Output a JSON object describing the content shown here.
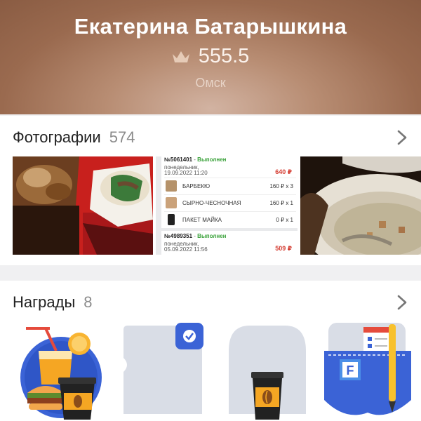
{
  "profile": {
    "name": "Екатерина Батарышкина",
    "score": "555.5",
    "city": "Омск",
    "crown_icon": "crown-icon"
  },
  "photos": {
    "title": "Фотографии",
    "count": "574",
    "chevron_icon": "chevron-right-icon",
    "items": [
      {
        "kind": "food-photo",
        "description": ""
      },
      {
        "kind": "receipt-screenshot",
        "orders": [
          {
            "number": "№5061401",
            "status": "Выполнен",
            "weekday": "понедельник,",
            "datetime": "19.09.2022 11:20",
            "total": "640 ₽",
            "items": [
              {
                "name": "БАРБЕКЮ",
                "qty": "160 ₽ x 3"
              },
              {
                "name": "СЫРНО-ЧЕСНОЧНАЯ",
                "qty": "160 ₽ x 1"
              },
              {
                "name": "ПАКЕТ МАЙКА",
                "qty": "0 ₽ x 1"
              }
            ]
          },
          {
            "number": "№4989351",
            "status": "Выполнен",
            "weekday": "понедельник,",
            "datetime": "05.09.2022 11:56",
            "total": "509 ₽"
          }
        ]
      },
      {
        "kind": "soup-photo"
      }
    ]
  },
  "awards": {
    "title": "Награды",
    "count": "8",
    "chevron_icon": "chevron-right-icon",
    "badges": [
      {
        "icon": "fast-food-badge-icon"
      },
      {
        "icon": "locked-verified-badge-icon"
      },
      {
        "icon": "coffee-cup-badge-icon"
      },
      {
        "icon": "pocket-notebook-badge-icon"
      }
    ]
  },
  "colors": {
    "header_bg": "#a87b61",
    "status_green": "#3aa23a",
    "price_red": "#d43a2f",
    "badge_blue": "#3b63d6",
    "badge_grey": "#d9dde6"
  }
}
